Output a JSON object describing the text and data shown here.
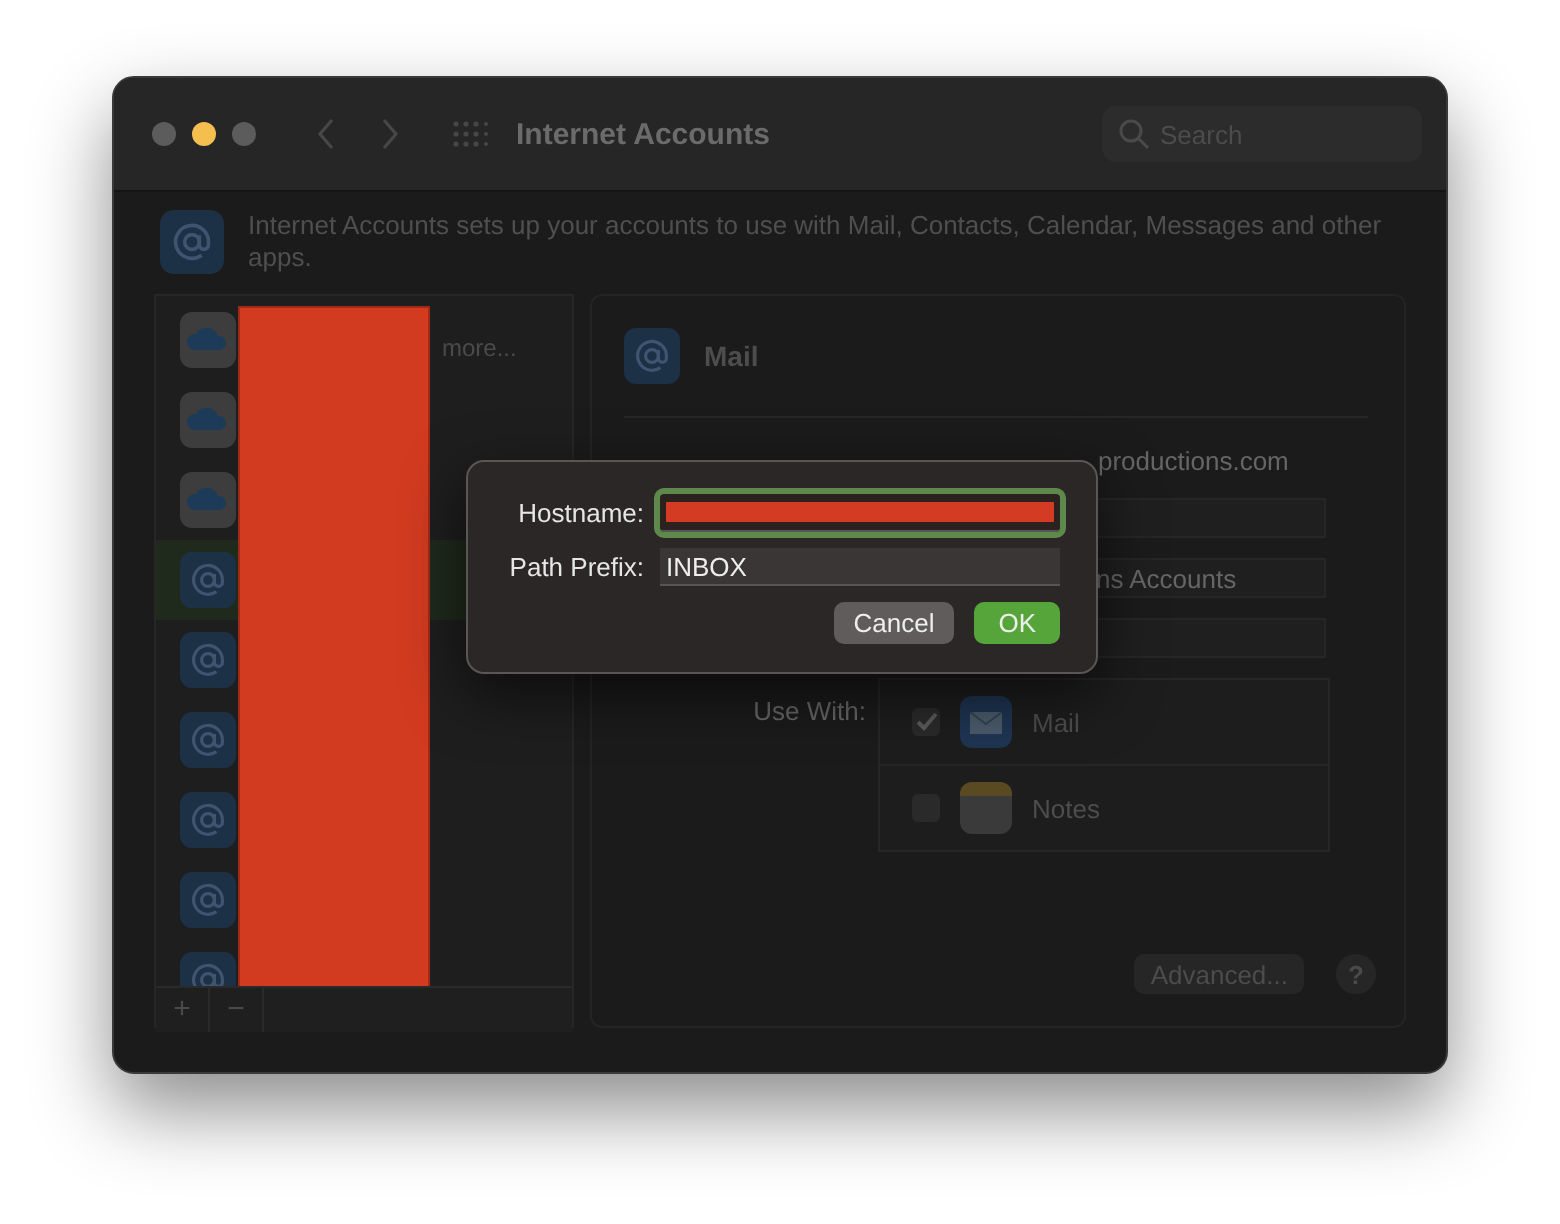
{
  "window": {
    "title": "Internet Accounts",
    "search": {
      "placeholder": "Search"
    }
  },
  "description": "Internet Accounts sets up your accounts to use with Mail, Contacts, Calendar, Messages and other apps.",
  "sidebar": {
    "items": [
      {
        "kind": "cloud",
        "label": "more...",
        "selected": false,
        "redacted": true
      },
      {
        "kind": "cloud",
        "selected": false,
        "redacted": true
      },
      {
        "kind": "cloud",
        "selected": false,
        "redacted": true
      },
      {
        "kind": "at",
        "selected": true,
        "redacted": true
      },
      {
        "kind": "at",
        "selected": false,
        "redacted": true
      },
      {
        "kind": "at",
        "selected": false,
        "redacted": true
      },
      {
        "kind": "at",
        "selected": false,
        "redacted": true
      },
      {
        "kind": "at",
        "selected": false,
        "redacted": true
      },
      {
        "kind": "at",
        "selected": false,
        "redacted": true
      }
    ],
    "toolbar": [
      "+",
      "−"
    ]
  },
  "account": {
    "title": "Mail",
    "rows": [
      {
        "kind": "text",
        "value": "productions.com"
      },
      {
        "kind": "field"
      },
      {
        "kind": "field",
        "value": "ns Accounts"
      },
      {
        "kind": "field"
      }
    ],
    "use_with_label": "Use With:",
    "apps": [
      {
        "kind": "mail",
        "name": "Mail",
        "checked": true
      },
      {
        "kind": "notes",
        "name": "Notes",
        "checked": false
      }
    ],
    "advanced_button": "Advanced...",
    "help_button": "?"
  },
  "dialog": {
    "fields": [
      {
        "label": "Hostname:",
        "focused": true,
        "redacted": true
      },
      {
        "label": "Path Prefix:",
        "value": "INBOX",
        "focused": false,
        "redacted": false
      }
    ],
    "buttons": [
      {
        "label": "Cancel",
        "default": false
      },
      {
        "label": "OK",
        "default": true
      }
    ]
  }
}
